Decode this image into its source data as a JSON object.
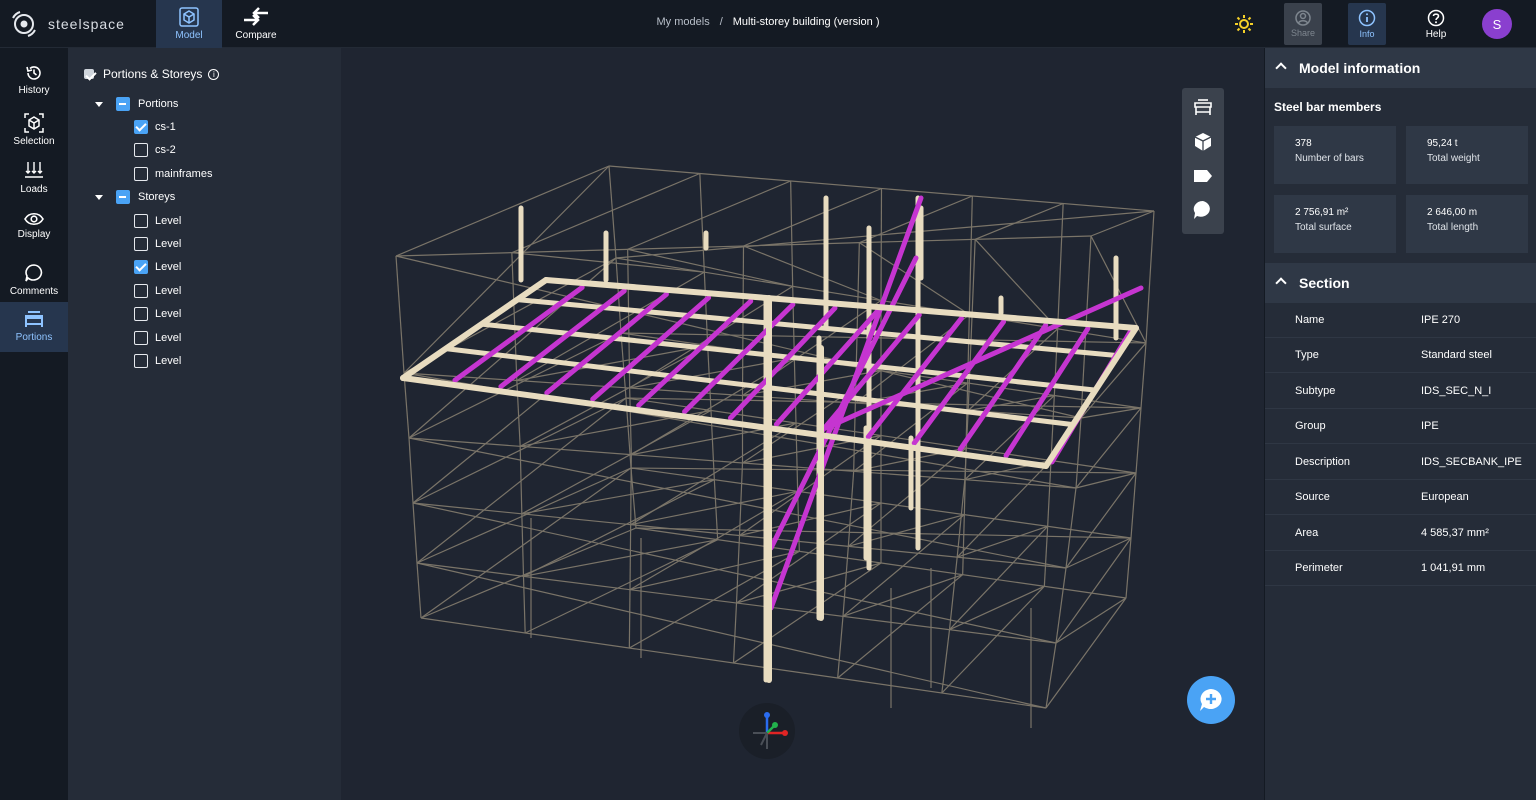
{
  "app": {
    "name": "steelspace"
  },
  "topbar": {
    "model_label": "Model",
    "compare_label": "Compare",
    "breadcrumb": {
      "parent": "My models",
      "separator": "/",
      "current": "Multi-storey building (version )"
    },
    "share_label": "Share",
    "info_label": "Info",
    "help_label": "Help",
    "avatar_initial": "S"
  },
  "leftnav": {
    "items": [
      {
        "label": "History",
        "icon": "history-icon"
      },
      {
        "label": "Selection",
        "icon": "cube-select-icon"
      },
      {
        "label": "Loads",
        "icon": "loads-arrows-icon"
      },
      {
        "label": "Display",
        "icon": "eye-icon"
      },
      {
        "label": "Comments",
        "icon": "comment-icon"
      },
      {
        "label": "Portions",
        "icon": "portions-icon"
      }
    ],
    "active": "Portions"
  },
  "tree": {
    "title": "Portions & Storeys",
    "portions_label": "Portions",
    "portions": [
      {
        "label": "cs-1",
        "checked": true
      },
      {
        "label": "cs-2",
        "checked": false
      },
      {
        "label": "mainframes",
        "checked": false
      }
    ],
    "storeys_label": "Storeys",
    "storeys": [
      {
        "label": "Level",
        "checked": false
      },
      {
        "label": "Level",
        "checked": false
      },
      {
        "label": "Level",
        "checked": true
      },
      {
        "label": "Level",
        "checked": false
      },
      {
        "label": "Level",
        "checked": false
      },
      {
        "label": "Level",
        "checked": false
      },
      {
        "label": "Level",
        "checked": false
      }
    ]
  },
  "model_info": {
    "title": "Model information",
    "subtitle": "Steel bar members",
    "stats": [
      {
        "value": "378",
        "caption": "Number of bars"
      },
      {
        "value": "95,24 t",
        "caption": "Total weight"
      },
      {
        "value": "2 756,91 m²",
        "caption": "Total surface"
      },
      {
        "value": "2 646,00 m",
        "caption": "Total length"
      }
    ]
  },
  "section": {
    "title": "Section",
    "rows": [
      {
        "key": "Name",
        "value": "IPE 270"
      },
      {
        "key": "Type",
        "value": "Standard steel"
      },
      {
        "key": "Subtype",
        "value": "IDS_SEC_N_I"
      },
      {
        "key": "Group",
        "value": "IPE"
      },
      {
        "key": "Description",
        "value": "IDS_SECBANK_IPE"
      },
      {
        "key": "Source",
        "value": "European"
      },
      {
        "key": "Area",
        "value": "4 585,37 mm²"
      },
      {
        "key": "Perimeter",
        "value": "1 041,91 mm"
      }
    ]
  },
  "colors": {
    "accent": "#4aa3f5",
    "highlight_beam": "#c535d0",
    "selected_beam": "#e8dcc0",
    "wire": "#8a8272"
  }
}
